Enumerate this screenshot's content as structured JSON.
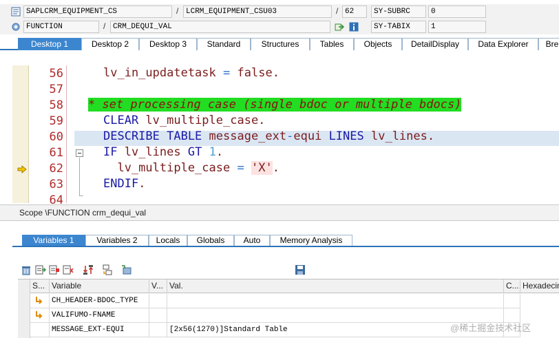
{
  "header": {
    "program": "SAPLCRM_EQUIPMENT_CS",
    "include": "LCRM_EQUIPMENT_CSU03",
    "line": "62",
    "sy_field_1": "SY-SUBRC",
    "sy_value_1": "0",
    "event_type": "FUNCTION",
    "event_name": "CRM_DEQUI_VAL",
    "sy_field_2": "SY-TABIX",
    "sy_value_2": "1",
    "separator": "/"
  },
  "tabs": [
    "Desktop 1",
    "Desktop 2",
    "Desktop 3",
    "Standard",
    "Structures",
    "Tables",
    "Objects",
    "DetailDisplay",
    "Data Explorer",
    "Bre"
  ],
  "code": {
    "lines": [
      {
        "no": "56",
        "tokens": [
          {
            "t": "lv_in_updatetask",
            "c": "var"
          },
          {
            "t": " ",
            "c": ""
          },
          {
            "t": "=",
            "c": "op"
          },
          {
            "t": " ",
            "c": ""
          },
          {
            "t": "false",
            "c": "var"
          },
          {
            "t": ".",
            "c": "var"
          }
        ]
      },
      {
        "no": "57",
        "tokens": []
      },
      {
        "no": "58",
        "tokens": [
          {
            "t": "* set processing case (single bdoc or multiple bdocs)",
            "c": "cmt"
          }
        ]
      },
      {
        "no": "59",
        "tokens": [
          {
            "t": "CLEAR",
            "c": "kw"
          },
          {
            "t": " lv_multiple_case.",
            "c": "var"
          }
        ]
      },
      {
        "no": "60",
        "tokens": [
          {
            "t": "DESCRIBE TABLE",
            "c": "kw"
          },
          {
            "t": " message_ext",
            "c": "var"
          },
          {
            "t": "-",
            "c": "op"
          },
          {
            "t": "equi",
            "c": "var"
          },
          {
            "t": " LINES",
            "c": "kw"
          },
          {
            "t": " lv_lines.",
            "c": "var"
          }
        ]
      },
      {
        "no": "61",
        "tokens": [
          {
            "t": "IF",
            "c": "kw"
          },
          {
            "t": " lv_lines ",
            "c": "var"
          },
          {
            "t": "GT",
            "c": "kw"
          },
          {
            "t": " ",
            "c": ""
          },
          {
            "t": "1",
            "c": "num"
          },
          {
            "t": ".",
            "c": "var"
          }
        ]
      },
      {
        "no": "62",
        "tokens": [
          {
            "t": "  lv_multiple_case ",
            "c": "var"
          },
          {
            "t": "=",
            "c": "op"
          },
          {
            "t": " ",
            "c": ""
          },
          {
            "t": "'X'",
            "c": "str"
          },
          {
            "t": ".",
            "c": "var"
          }
        ]
      },
      {
        "no": "63",
        "tokens": [
          {
            "t": "ENDIF",
            "c": "kw"
          },
          {
            "t": ".",
            "c": "var"
          }
        ]
      },
      {
        "no": "64",
        "tokens": []
      }
    ]
  },
  "scope": "Scope \\FUNCTION crm_dequi_val",
  "var_tabs": [
    "Variables 1",
    "Variables 2",
    "Locals",
    "Globals",
    "Auto",
    "Memory Analysis"
  ],
  "grid": {
    "headers": [
      "S...",
      "Variable",
      "V...",
      "Val.",
      "C...",
      "Hexadecim"
    ],
    "rows": [
      {
        "variable": "CH_HEADER-BDOC_TYPE",
        "value": ""
      },
      {
        "variable": "VALIFUMO-FNAME",
        "value": ""
      },
      {
        "variable": "MESSAGE_EXT-EQUI",
        "value": "[2x56(1270)]Standard Table"
      }
    ]
  },
  "watermark": "@稀土掘金技术社区",
  "colors": {
    "accent": "#3c86d0",
    "comment_bg": "#22dd22",
    "keyword": "#1a1aa6"
  }
}
